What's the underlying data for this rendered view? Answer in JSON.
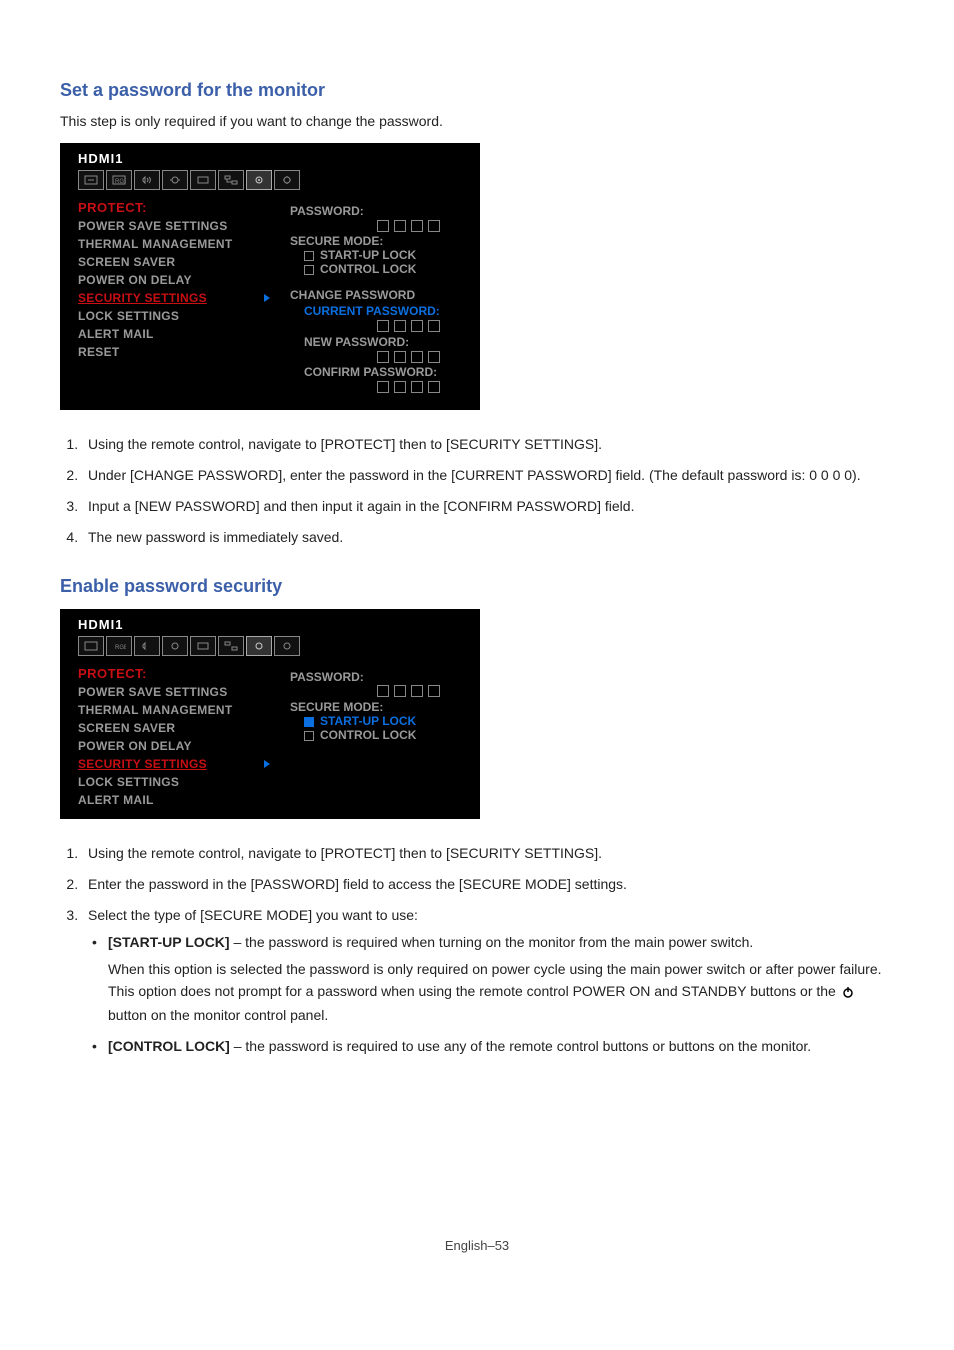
{
  "section1": {
    "heading": "Set a password for the monitor",
    "intro": "This step is only required if you want to change the password."
  },
  "osd1": {
    "source": "HDMI1",
    "menu_header": "PROTECT:",
    "items": [
      "POWER SAVE SETTINGS",
      "THERMAL MANAGEMENT",
      "SCREEN SAVER",
      "POWER ON DELAY",
      "SECURITY SETTINGS",
      "LOCK SETTINGS",
      "ALERT MAIL",
      "RESET"
    ],
    "right": {
      "password_label": "PASSWORD:",
      "secure_mode_label": "SECURE MODE:",
      "opt_startup": "START-UP LOCK",
      "opt_control": "CONTROL LOCK",
      "change_pw_label": "CHANGE PASSWORD",
      "current_pw_label": "CURRENT PASSWORD:",
      "new_pw_label": "NEW PASSWORD:",
      "confirm_pw_label": "CONFIRM PASSWORD:"
    }
  },
  "steps1": {
    "s1": "Using the remote control, navigate to [PROTECT] then to [SECURITY SETTINGS].",
    "s2": "Under [CHANGE PASSWORD], enter the password in the [CURRENT PASSWORD] field. (The default password is: 0 0 0 0).",
    "s3": "Input a [NEW PASSWORD] and then input it again in the [CONFIRM PASSWORD] field.",
    "s4": "The new password is immediately saved."
  },
  "section2": {
    "heading": "Enable password security"
  },
  "osd2": {
    "source": "HDMI1",
    "menu_header": "PROTECT:",
    "items": [
      "POWER SAVE SETTINGS",
      "THERMAL MANAGEMENT",
      "SCREEN SAVER",
      "POWER ON DELAY",
      "SECURITY SETTINGS",
      "LOCK SETTINGS",
      "ALERT MAIL"
    ],
    "right": {
      "password_label": "PASSWORD:",
      "secure_mode_label": "SECURE MODE:",
      "opt_startup": "START-UP LOCK",
      "opt_control": "CONTROL LOCK"
    }
  },
  "steps2": {
    "s1": "Using the remote control, navigate to [PROTECT] then to [SECURITY SETTINGS].",
    "s2": "Enter the password in the [PASSWORD] field to access the [SECURE MODE] settings.",
    "s3": "Select the type of [SECURE MODE] you want to use:",
    "b1_lead": "[START-UP LOCK]",
    "b1_rest": " – the password is required when turning on the monitor from the main power switch.",
    "b1_para_a": "When this option is selected the password is only required on power cycle using the main power switch or after power failure. This option does not prompt for a password when using the remote control POWER ON and STANDBY buttons or the ",
    "b1_para_b": " button on the monitor control panel.",
    "b2_lead": "[CONTROL LOCK]",
    "b2_rest": " – the password is required to use any of the remote control buttons or buttons on the monitor."
  },
  "footer": "English–53"
}
